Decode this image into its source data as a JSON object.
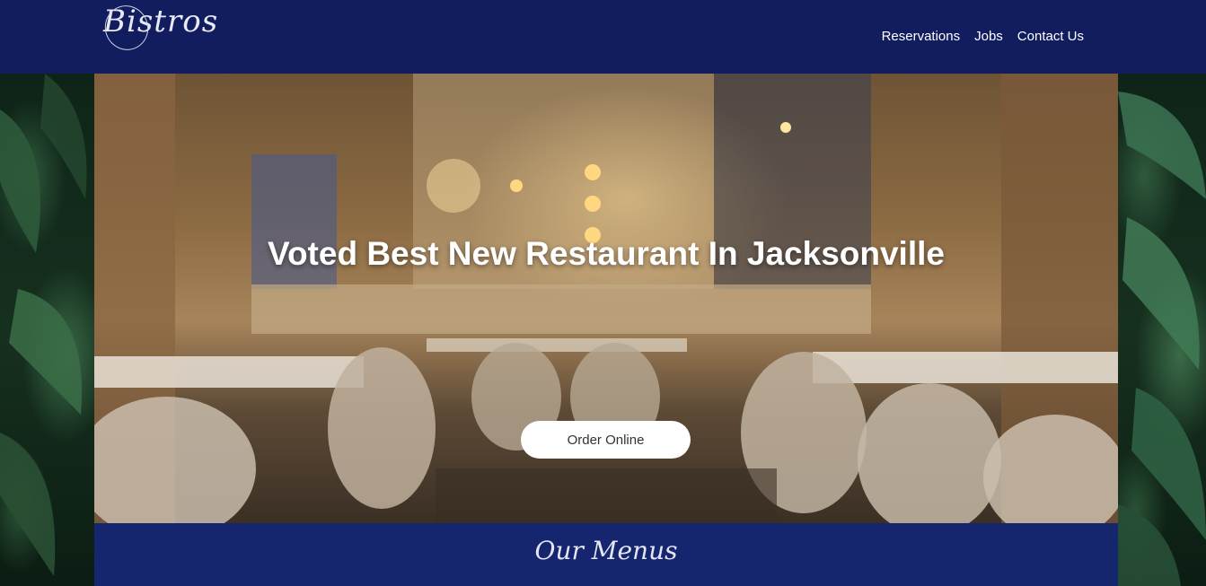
{
  "header": {
    "logo_text": "Bistros",
    "nav": [
      {
        "label": "Reservations"
      },
      {
        "label": "Jobs"
      },
      {
        "label": "Contact Us"
      }
    ]
  },
  "hero": {
    "title": "Voted Best New Restaurant In Jacksonville",
    "cta_label": "Order Online"
  },
  "menus": {
    "title": "Our Menus"
  },
  "colors": {
    "navbar": "#111d5e",
    "menus_band": "#16266e",
    "button_bg": "#ffffff"
  }
}
